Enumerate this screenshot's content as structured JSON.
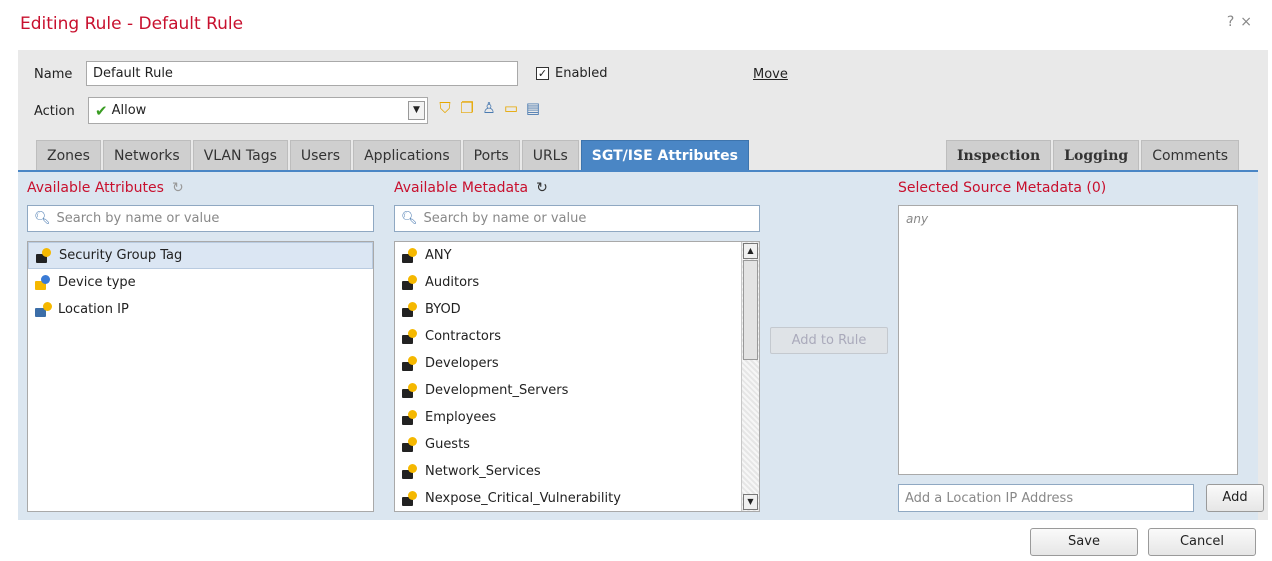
{
  "window": {
    "title": "Editing Rule - Default Rule",
    "help_label": "?",
    "close_label": "×"
  },
  "rule": {
    "name_label": "Name",
    "name_value": "Default Rule",
    "enabled_label": "Enabled",
    "enabled_checked": true,
    "move_label": "Move",
    "action_label": "Action",
    "action_value": "Allow"
  },
  "toolbar_icons": [
    "shield-icon",
    "copy-icon",
    "user-search-icon",
    "folder-icon",
    "document-icon"
  ],
  "tabs_left": [
    {
      "label": "Zones"
    },
    {
      "label": "Networks"
    },
    {
      "label": "VLAN Tags"
    },
    {
      "label": "Users"
    },
    {
      "label": "Applications"
    },
    {
      "label": "Ports"
    },
    {
      "label": "URLs"
    },
    {
      "label": "SGT/ISE Attributes",
      "active": true
    }
  ],
  "tabs_right": [
    {
      "label": "Inspection"
    },
    {
      "label": "Logging"
    },
    {
      "label": "Comments"
    }
  ],
  "available_attributes": {
    "title": "Available Attributes",
    "search_placeholder": "Search by name or value",
    "items": [
      {
        "label": "Security Group Tag",
        "selected": true,
        "icon": "tag-lock-icon"
      },
      {
        "label": "Device type",
        "icon": "device-icon"
      },
      {
        "label": "Location IP",
        "icon": "location-icon"
      }
    ]
  },
  "available_metadata": {
    "title": "Available Metadata",
    "search_placeholder": "Search by name or value",
    "items": [
      "ANY",
      "Auditors",
      "BYOD",
      "Contractors",
      "Developers",
      "Development_Servers",
      "Employees",
      "Guests",
      "Network_Services",
      "Nexpose_Critical_Vulnerability"
    ]
  },
  "add_to_rule_label": "Add to Rule",
  "selected_source": {
    "title": "Selected Source Metadata (0)",
    "placeholder_item": "any",
    "ip_placeholder": "Add a Location IP Address",
    "add_label": "Add"
  },
  "footer": {
    "save_label": "Save",
    "cancel_label": "Cancel"
  },
  "colors": {
    "title_red": "#c8102e",
    "active_tab_blue": "#4a86c5",
    "content_bg": "#dbe6f0"
  }
}
